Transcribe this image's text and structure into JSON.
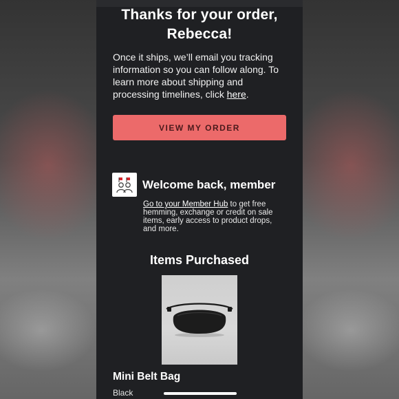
{
  "email": {
    "heading": "Thanks for your order, Rebecca!",
    "intro_text": "Once it ships, we’ll email you tracking information so you can follow along. To learn more about shipping and processing timelines, click ",
    "intro_link": "here",
    "intro_end": ".",
    "view_order_button": "VIEW MY ORDER",
    "accent_color": "#ec6a6a"
  },
  "member": {
    "icon": "member-people-icon",
    "title": "Welcome back, member",
    "hub_link": "Go to your Member Hub",
    "text": " to get free hemming, exchange or credit on sale items, early access to product drops, and more."
  },
  "items": {
    "title": "Items Purchased",
    "products": [
      {
        "image_icon": "belt-bag-image",
        "name": "Mini Belt Bag",
        "color": "Black"
      }
    ]
  }
}
